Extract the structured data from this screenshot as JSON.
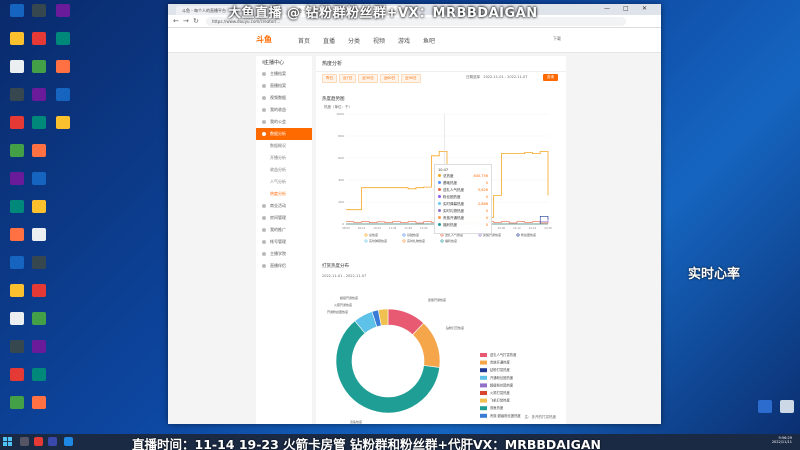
{
  "browser": {
    "tab1": "斗鱼 - 每个人的直播平台",
    "tab2": "斗鱼 -",
    "url": "https://www.douyu.com/creator/..."
  },
  "site": {
    "logo": "斗鱼",
    "nav": [
      "首页",
      "直播",
      "分类",
      "视频",
      "游戏",
      "鱼吧"
    ],
    "user": "下载"
  },
  "sidebar": {
    "title": "主播中心",
    "items": [
      {
        "label": "主播档案"
      },
      {
        "label": "直播档案"
      },
      {
        "label": "视频数据"
      },
      {
        "label": "我的收益"
      },
      {
        "label": "我的公会"
      },
      {
        "label": "数据分析",
        "active": true
      },
      {
        "label": "数据概况",
        "sub": true
      },
      {
        "label": "开播分析",
        "sub": true
      },
      {
        "label": "收益分析",
        "sub": true
      },
      {
        "label": "人气分析",
        "sub": true
      },
      {
        "label": "热度分析",
        "sub": true,
        "selected": true
      },
      {
        "label": "商业活动"
      },
      {
        "label": "房间管理"
      },
      {
        "label": "我的推广"
      },
      {
        "label": "帐号管理"
      },
      {
        "label": "主播学院"
      },
      {
        "label": "直播伴侣"
      }
    ]
  },
  "main": {
    "title": "热度分析",
    "filters": [
      "昨日",
      "近7日",
      "近30日",
      "近60日",
      "近90日"
    ],
    "date_label": "日期选择",
    "date_range": "2022-11-01 - 2022-11-07",
    "query_button": "查询",
    "section1": "热度趋势图",
    "section2": "打赏热度分布",
    "section2_date": "2022-11-01 - 2022-11-07",
    "note": "注：多开的打赏热度"
  },
  "chart_data": [
    {
      "type": "line",
      "ylabel": "热度（单位：千）",
      "x": [
        "08:00",
        "08:36",
        "09:12",
        "09:48",
        "10:24",
        "11:00",
        "11:36",
        "12:12",
        "12:48",
        "13:24",
        "14:00",
        "14:36",
        "15:12",
        "15:48",
        "16:24",
        "17:00",
        "17:36",
        "18:12",
        "18:48",
        "19:24",
        "20:00",
        "20:36",
        "21:12",
        "21:48",
        "22:24",
        "23:00",
        "23:36"
      ],
      "ylim": [
        0,
        1000
      ],
      "series": [
        {
          "name": "总热度",
          "values": [
            130,
            130,
            330,
            330,
            330,
            330,
            330,
            330,
            320,
            330,
            335,
            620,
            660,
            300,
            60,
            60,
            60,
            60,
            60,
            260,
            640,
            640,
            640,
            650,
            640,
            660,
            260
          ]
        },
        {
          "name": "基础热度",
          "values": [
            2,
            2,
            2,
            2,
            2,
            2,
            2,
            2,
            2,
            2,
            2,
            2,
            2,
            2,
            2,
            2,
            2,
            2,
            2,
            2,
            2,
            2,
            2,
            2,
            2,
            2,
            2
          ]
        },
        {
          "name": "送礼人气热度",
          "values": [
            22,
            15,
            22,
            12,
            20,
            12,
            22,
            14,
            22,
            10,
            22,
            14,
            22,
            10,
            22,
            14,
            22,
            10,
            22,
            14,
            22,
            10,
            22,
            14,
            22,
            10,
            22
          ]
        },
        {
          "name": "贵族开通热度",
          "values": [
            0,
            0,
            0,
            0,
            0,
            0,
            0,
            0,
            0,
            0,
            0,
            0,
            0,
            0,
            0,
            0,
            0,
            0,
            0,
            0,
            0,
            0,
            0,
            0,
            0,
            20,
            60
          ]
        },
        {
          "name": "粉丝团热度",
          "values": [
            0,
            0,
            0,
            0,
            0,
            0,
            0,
            0,
            0,
            0,
            0,
            0,
            0,
            0,
            0,
            0,
            0,
            0,
            0,
            0,
            0,
            0,
            0,
            0,
            0,
            70,
            40
          ]
        },
        {
          "name": "实时弹幕热度",
          "values": [
            0,
            0,
            0,
            0,
            0,
            0,
            0,
            0,
            0,
            0,
            0,
            0,
            0,
            0,
            0,
            0,
            0,
            0,
            0,
            0,
            0,
            0,
            0,
            0,
            0,
            0,
            0
          ]
        },
        {
          "name": "实时礼物热度",
          "values": [
            0,
            0,
            0,
            0,
            0,
            0,
            0,
            0,
            0,
            0,
            0,
            0,
            0,
            0,
            0,
            0,
            0,
            0,
            0,
            0,
            0,
            0,
            0,
            0,
            0,
            0,
            0
          ]
        },
        {
          "name": "福利热度",
          "values": [
            0,
            0,
            0,
            0,
            0,
            0,
            0,
            0,
            0,
            0,
            0,
            0,
            0,
            0,
            0,
            0,
            0,
            0,
            0,
            0,
            0,
            0,
            0,
            0,
            0,
            0,
            0
          ]
        }
      ],
      "tooltip": {
        "time": "10:47",
        "rows": [
          {
            "name": "总热度",
            "value": "640,756",
            "color": "#f5a623"
          },
          {
            "name": "基础热度",
            "value": "0",
            "color": "#5b8ff9"
          },
          {
            "name": "送礼人气热度",
            "value": "5,626",
            "color": "#e8684a"
          },
          {
            "name": "粉丝团热度",
            "value": "0",
            "color": "#8b5cf6"
          },
          {
            "name": "实时弹幕热度",
            "value": "2,886",
            "color": "#6dc8ec"
          },
          {
            "name": "实时礼物热度",
            "value": "0",
            "color": "#9270ca"
          },
          {
            "name": "贵族开通热度",
            "value": "0",
            "color": "#ff9d4d"
          },
          {
            "name": "福利热度",
            "value": "0",
            "color": "#269a99"
          }
        ]
      }
    },
    {
      "type": "pie",
      "slices": [
        {
          "label": "贵族开通热度",
          "value": 12,
          "color": "#e75a72"
        },
        {
          "label": "贵族续费热度",
          "value": 15,
          "color": "#f5a64a"
        },
        {
          "label": "双鱼热度",
          "value": 62,
          "color": "#1f9e95"
        },
        {
          "label": "开通粉丝团热度",
          "value": 6,
          "color": "#5ec1e8"
        },
        {
          "label": "超级粉丝团热度",
          "value": 2,
          "color": "#3a7bd5"
        },
        {
          "label": "其他",
          "value": 3,
          "color": "#f0c050"
        }
      ],
      "outer_labels": [
        "贵族开通热度",
        "钻粉打赏热度",
        "超级开通热度",
        "火箭开通热度",
        "开通粉丝团热度",
        "双鱼热度"
      ],
      "legend": [
        "送礼人气打赏热度",
        "贵族开通热度",
        "钻粉打赏热度",
        "开通粉丝团热度",
        "超级粉丝团热度",
        "火箭打赏热度",
        "飞机打赏热度",
        "双鱼热度",
        "贵族·超级粉丝团热度"
      ]
    }
  ],
  "overlay": {
    "top": "大鱼直播 @ 钻粉群粉丝群+VX：MRBBDAIGAN",
    "right": "实时心率",
    "bottom": "直播时间：11-14 19-23 火箭卡房管 钻粉群和粉丝群+代肝VX：MRBBDAIGAN"
  },
  "tray": {
    "time": "9:56:29",
    "date": "2022/11/11"
  }
}
